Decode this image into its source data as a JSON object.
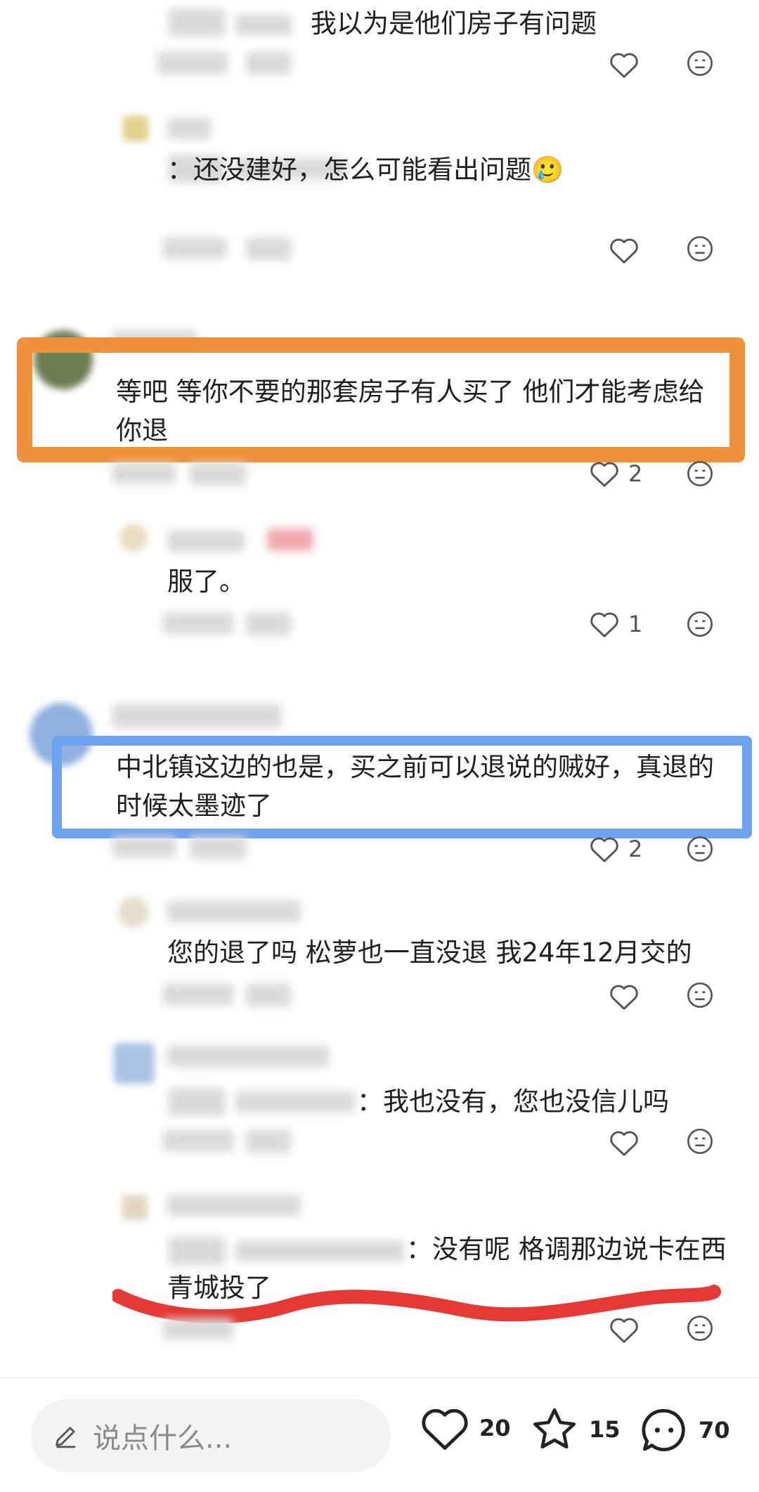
{
  "comments": [
    {
      "id": "c1",
      "text": "我以为是他们房子有问题",
      "likes": ""
    },
    {
      "id": "c2",
      "text": "：还没建好，怎么可能看出问题🥲",
      "likes": ""
    },
    {
      "id": "c3",
      "text": "等吧 等你不要的那套房子有人买了 他们才能考虑给你退",
      "likes": "2"
    },
    {
      "id": "c4",
      "text": "服了。",
      "likes": "1"
    },
    {
      "id": "c5",
      "text": "中北镇这边的也是，买之前可以退说的贼好，真退的时候太墨迹了",
      "likes": "2"
    },
    {
      "id": "c6",
      "text": "您的退了吗 松萝也一直没退 我24年12月交的",
      "likes": ""
    },
    {
      "id": "c7",
      "text": "：我也没有，您也没信儿吗",
      "likes": ""
    },
    {
      "id": "c8",
      "text": "：没有呢 格调那边说卡在西青城投了",
      "likes": ""
    }
  ],
  "bottom_bar": {
    "input_placeholder": "说点什么...",
    "like_count": "20",
    "star_count": "15",
    "comment_count": "70"
  },
  "colors": {
    "orange_highlight": "#f0913b",
    "blue_highlight": "#6ea3f2",
    "red_scribble": "#e53935"
  },
  "icons": [
    "heart-icon",
    "dislike-face-icon",
    "pencil-icon",
    "star-icon",
    "chat-bubble-icon"
  ]
}
